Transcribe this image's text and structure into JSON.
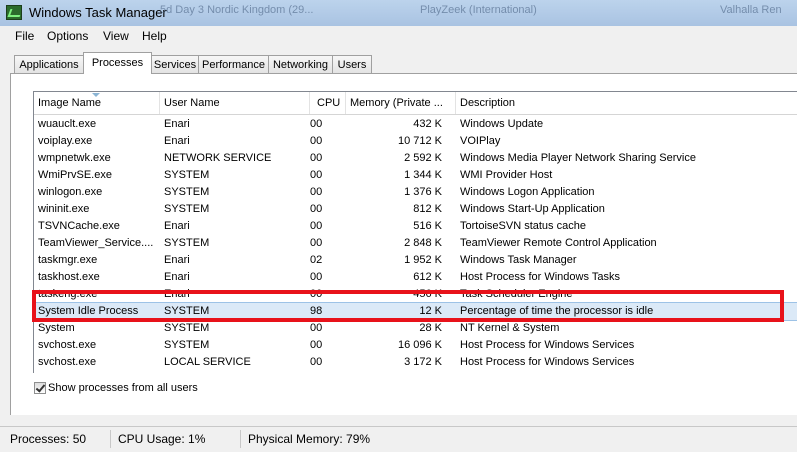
{
  "window": {
    "title": "Windows Task Manager",
    "background_tabs": [
      "5d Day 3 Nordic Kingdom (29...",
      "PlayZeek (International)",
      "Valhalla Ren"
    ]
  },
  "menu": [
    "File",
    "Options",
    "View",
    "Help"
  ],
  "tabs": [
    {
      "label": "Applications",
      "active": false
    },
    {
      "label": "Processes",
      "active": true
    },
    {
      "label": "Services",
      "active": false
    },
    {
      "label": "Performance",
      "active": false
    },
    {
      "label": "Networking",
      "active": false
    },
    {
      "label": "Users",
      "active": false
    }
  ],
  "columns": {
    "image_name": "Image Name",
    "user_name": "User Name",
    "cpu": "CPU",
    "memory": "Memory (Private ...",
    "description": "Description"
  },
  "processes": [
    {
      "name": "wuauclt.exe",
      "user": "Enari",
      "cpu": "00",
      "memory": "432 K",
      "description": "Windows Update"
    },
    {
      "name": "voiplay.exe",
      "user": "Enari",
      "cpu": "00",
      "memory": "10 712 K",
      "description": "VOIPlay"
    },
    {
      "name": "wmpnetwk.exe",
      "user": "NETWORK SERVICE",
      "cpu": "00",
      "memory": "2 592 K",
      "description": "Windows Media Player Network Sharing Service"
    },
    {
      "name": "WmiPrvSE.exe",
      "user": "SYSTEM",
      "cpu": "00",
      "memory": "1 344 K",
      "description": "WMI Provider Host"
    },
    {
      "name": "winlogon.exe",
      "user": "SYSTEM",
      "cpu": "00",
      "memory": "1 376 K",
      "description": "Windows Logon Application"
    },
    {
      "name": "wininit.exe",
      "user": "SYSTEM",
      "cpu": "00",
      "memory": "812 K",
      "description": "Windows Start-Up Application"
    },
    {
      "name": "TSVNCache.exe",
      "user": "Enari",
      "cpu": "00",
      "memory": "516 K",
      "description": "TortoiseSVN status cache"
    },
    {
      "name": "TeamViewer_Service....",
      "user": "SYSTEM",
      "cpu": "00",
      "memory": "2 848 K",
      "description": "TeamViewer Remote Control Application"
    },
    {
      "name": "taskmgr.exe",
      "user": "Enari",
      "cpu": "02",
      "memory": "1 952 K",
      "description": "Windows Task Manager"
    },
    {
      "name": "taskhost.exe",
      "user": "Enari",
      "cpu": "00",
      "memory": "612 K",
      "description": "Host Process for Windows Tasks"
    },
    {
      "name": "taskeng.exe",
      "user": "Enari",
      "cpu": "00",
      "memory": "456 K",
      "description": "Task Scheduler Engine"
    },
    {
      "name": "System Idle Process",
      "user": "SYSTEM",
      "cpu": "98",
      "memory": "12 K",
      "description": "Percentage of time the processor is idle",
      "selected": true
    },
    {
      "name": "System",
      "user": "SYSTEM",
      "cpu": "00",
      "memory": "28 K",
      "description": "NT Kernel & System"
    },
    {
      "name": "svchost.exe",
      "user": "SYSTEM",
      "cpu": "00",
      "memory": "16 096 K",
      "description": "Host Process for Windows Services"
    },
    {
      "name": "svchost.exe",
      "user": "LOCAL SERVICE",
      "cpu": "00",
      "memory": "3 172 K",
      "description": "Host Process for Windows Services"
    }
  ],
  "show_all_users": {
    "label": "Show processes from all users",
    "checked": true
  },
  "status": {
    "processes": "Processes: 50",
    "cpu_usage": "CPU Usage: 1%",
    "physical_memory": "Physical Memory: 79%"
  },
  "colors": {
    "highlight_box": "#e8121a",
    "selected_row": "#dbe9f7"
  }
}
